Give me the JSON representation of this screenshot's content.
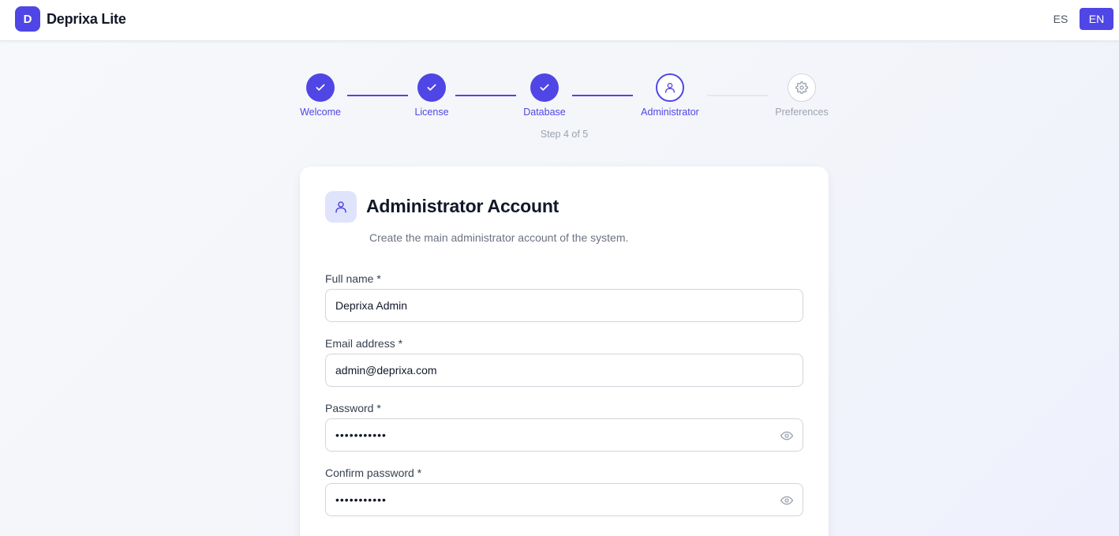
{
  "header": {
    "logo_letter": "D",
    "app_name": "Deprixa Lite",
    "languages": [
      {
        "code": "ES",
        "active": false
      },
      {
        "code": "EN",
        "active": true
      }
    ]
  },
  "stepper": {
    "steps": [
      {
        "label": "Welcome",
        "state": "done",
        "icon": "check-icon"
      },
      {
        "label": "License",
        "state": "done",
        "icon": "check-icon"
      },
      {
        "label": "Database",
        "state": "done",
        "icon": "check-icon"
      },
      {
        "label": "Administrator",
        "state": "current",
        "icon": "user-icon"
      },
      {
        "label": "Preferences",
        "state": "todo",
        "icon": "gear-icon"
      }
    ],
    "counter": "Step 4 of 5"
  },
  "card": {
    "icon": "user-icon",
    "title": "Administrator Account",
    "subtitle": "Create the main administrator account of the system.",
    "fields": {
      "full_name": {
        "label": "Full name *",
        "value": "Deprixa Admin"
      },
      "email": {
        "label": "Email address *",
        "value": "admin@deprixa.com"
      },
      "password": {
        "label": "Password *",
        "value": "admin123456",
        "icon": "eye-icon"
      },
      "confirm_password": {
        "label": "Confirm password *",
        "value": "admin123456",
        "icon": "eye-icon"
      }
    }
  },
  "colors": {
    "accent": "#4f46e5",
    "accent_light": "#e0e3fc",
    "muted": "#9ca3af",
    "border": "#d1d5db"
  }
}
